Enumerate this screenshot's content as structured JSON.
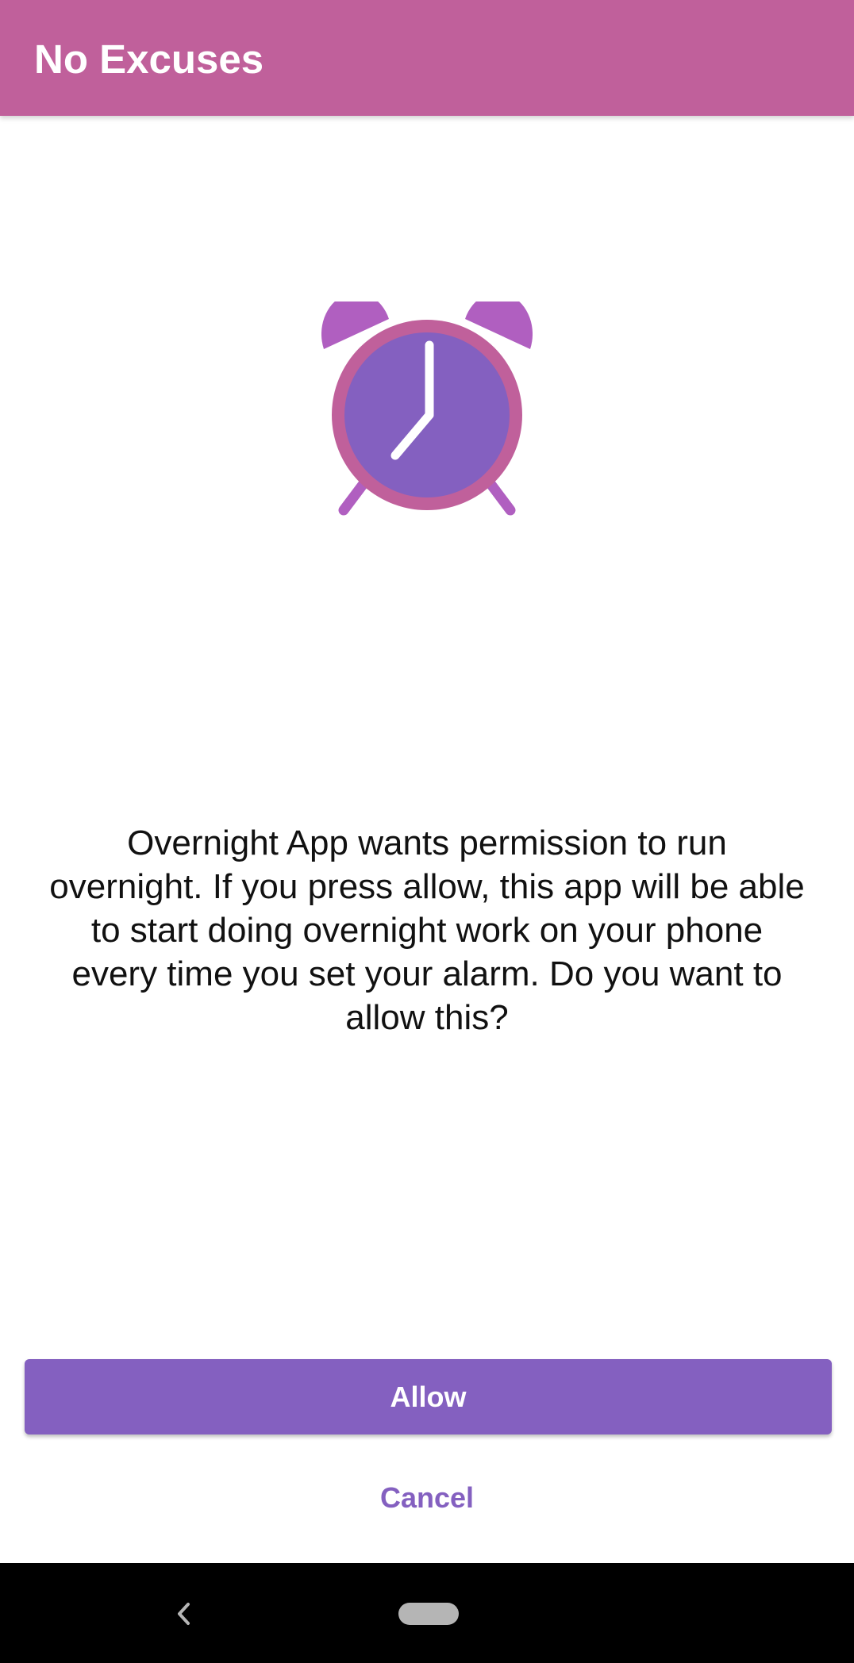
{
  "app_bar": {
    "title": "No Excuses",
    "background_color": "#c0609b"
  },
  "illustration": {
    "icon": "alarm-clock-icon",
    "colors": {
      "bells": "#b05fc0",
      "ring": "#c0609b",
      "face": "#8460c0",
      "hands": "#ffffff"
    }
  },
  "dialog": {
    "message": "Overnight App wants permission to run overnight. If you press allow, this app will be able to start doing overnight work on your phone every time you set your alarm. Do you want to allow this?"
  },
  "actions": {
    "allow_label": "Allow",
    "cancel_label": "Cancel",
    "accent_color": "#8460c0"
  },
  "system_nav": {
    "back_icon": "chevron-left-icon",
    "home_icon": "home-pill-icon"
  }
}
